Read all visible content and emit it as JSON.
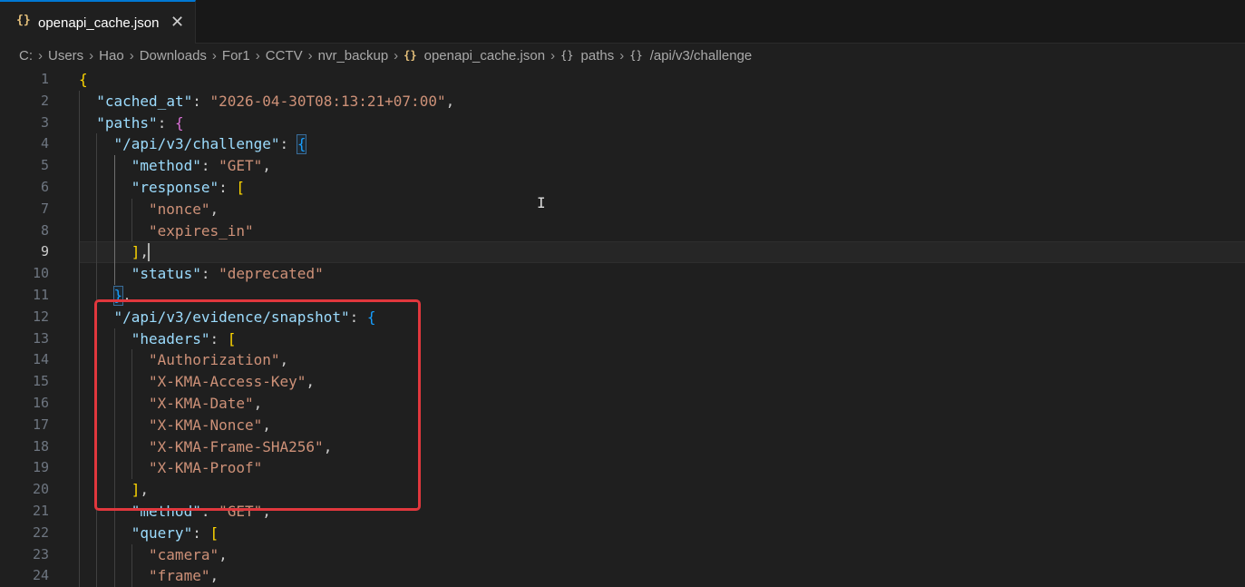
{
  "tab": {
    "icon": "braces-icon",
    "label": "openapi_cache.json",
    "close": "✕"
  },
  "breadcrumb": {
    "items": [
      "C:",
      "Users",
      "Hao",
      "Downloads",
      "For1",
      "CCTV",
      "nvr_backup"
    ],
    "file": "openapi_cache.json",
    "symbols": [
      "paths",
      "/api/v3/challenge"
    ]
  },
  "editor": {
    "current_line": 9,
    "lines": [
      {
        "n": "1",
        "t": "{"
      },
      {
        "n": "2",
        "t": "\"cached_at\": \"2026-04-30T08:13:21+07:00\","
      },
      {
        "n": "3",
        "t": "\"paths\": {"
      },
      {
        "n": "4",
        "t": "\"/api/v3/challenge\": {"
      },
      {
        "n": "5",
        "t": "\"method\": \"GET\","
      },
      {
        "n": "6",
        "t": "\"response\": ["
      },
      {
        "n": "7",
        "t": "\"nonce\","
      },
      {
        "n": "8",
        "t": "\"expires_in\""
      },
      {
        "n": "9",
        "t": "],"
      },
      {
        "n": "10",
        "t": "\"status\": \"deprecated\""
      },
      {
        "n": "11",
        "t": "},"
      },
      {
        "n": "12",
        "t": "\"/api/v3/evidence/snapshot\": {"
      },
      {
        "n": "13",
        "t": "\"headers\": ["
      },
      {
        "n": "14",
        "t": "\"Authorization\","
      },
      {
        "n": "15",
        "t": "\"X-KMA-Access-Key\","
      },
      {
        "n": "16",
        "t": "\"X-KMA-Date\","
      },
      {
        "n": "17",
        "t": "\"X-KMA-Nonce\","
      },
      {
        "n": "18",
        "t": "\"X-KMA-Frame-SHA256\","
      },
      {
        "n": "19",
        "t": "\"X-KMA-Proof\""
      },
      {
        "n": "20",
        "t": "],"
      },
      {
        "n": "21",
        "t": "\"method\": \"GET\","
      },
      {
        "n": "22",
        "t": "\"query\": ["
      },
      {
        "n": "23",
        "t": "\"camera\","
      },
      {
        "n": "24",
        "t": "\"frame\","
      }
    ]
  },
  "colors": {
    "accent": "#0078d4",
    "highlight_box": "#e0373d",
    "json_key": "#9cdcfe",
    "json_string": "#ce9178"
  }
}
